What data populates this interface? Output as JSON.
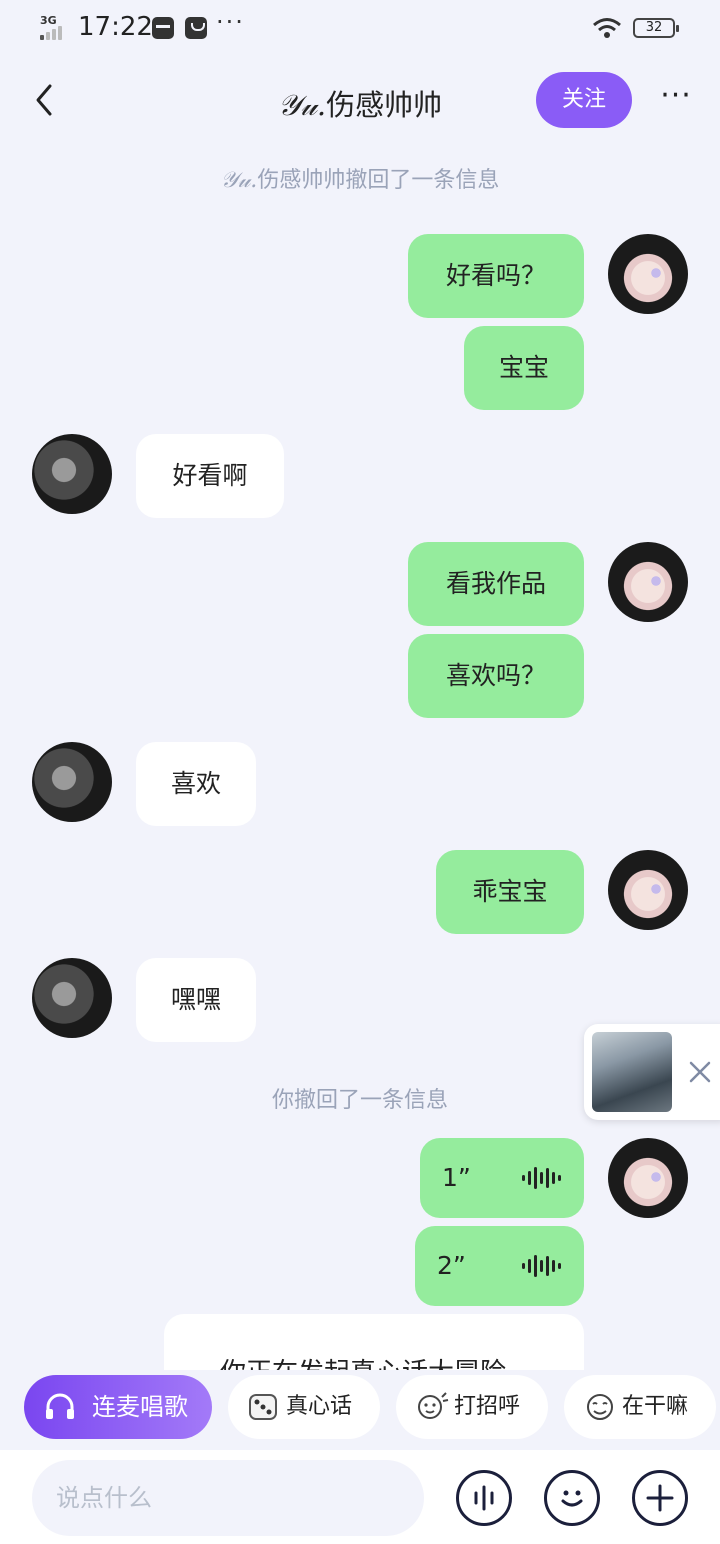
{
  "status_bar": {
    "network": "3G",
    "time": "17:22",
    "battery": "32"
  },
  "header": {
    "title_script": "𝒴𝓊.",
    "title_main": "伤感帅帅",
    "follow_label": "关注"
  },
  "notices": {
    "top_recall_name": "𝒴𝓊.",
    "top_recall_text": "伤感帅帅撤回了一条信息",
    "self_recall": "你撤回了一条信息"
  },
  "messages": [
    {
      "side": "sent",
      "text": "好看吗？"
    },
    {
      "side": "sent",
      "text": "宝宝"
    },
    {
      "side": "received",
      "text": "好看啊"
    },
    {
      "side": "sent",
      "text": "看我作品"
    },
    {
      "side": "sent",
      "text": "喜欢吗？"
    },
    {
      "side": "received",
      "text": "喜欢"
    },
    {
      "side": "sent",
      "text": "乖宝宝"
    },
    {
      "side": "received",
      "text": "嘿嘿"
    }
  ],
  "voice_messages": [
    {
      "duration": "1”"
    },
    {
      "duration": "2”"
    }
  ],
  "game_card": {
    "text": "你正在发起真心话大冒险"
  },
  "quick_actions": [
    {
      "label": "连麦唱歌",
      "icon": "headphones-icon"
    },
    {
      "label": "真心话",
      "icon": "dice-icon"
    },
    {
      "label": "打招呼",
      "icon": "wave-hand-icon"
    },
    {
      "label": "在干嘛",
      "icon": "face-icon"
    }
  ],
  "input": {
    "placeholder": "说点什么"
  },
  "colors": {
    "accent": "#8a5cf6",
    "sent_bubble": "#95ec9d",
    "received_bubble": "#ffffff",
    "background": "#f2f3fb"
  }
}
